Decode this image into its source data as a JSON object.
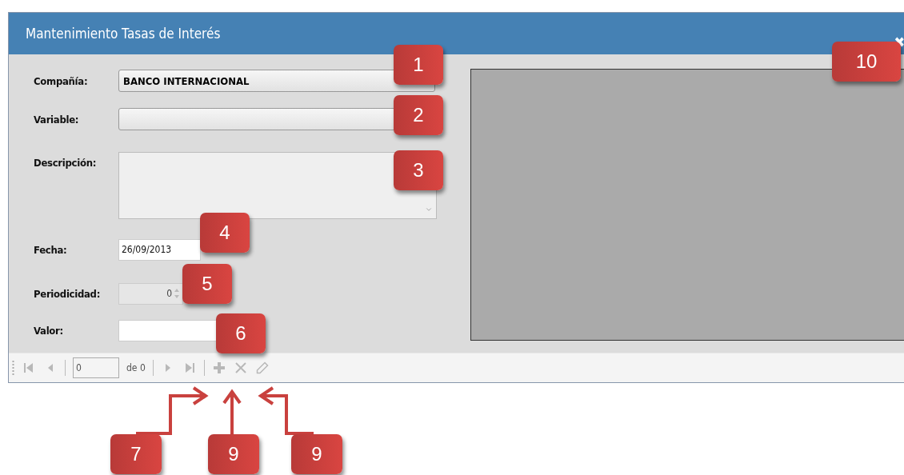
{
  "window": {
    "title": "Mantenimiento Tasas de Interés",
    "close": "✖"
  },
  "form": {
    "fields": [
      {
        "kind": "select",
        "label": "Compañía:",
        "value": "BANCO INTERNACIONAL",
        "disabled": false
      },
      {
        "kind": "select",
        "label": "Variable:",
        "disabled": false
      },
      {
        "kind": "textarea",
        "label": "Descripción:",
        "disabled": false
      },
      {
        "kind": "date",
        "label": "Fecha:",
        "value": "26/09/2013",
        "disabled": false
      },
      {
        "kind": "spinner",
        "label": "Periodicidad:",
        "value": "0",
        "disabled": true
      },
      {
        "kind": "text",
        "label": "Valor:",
        "disabled": false
      }
    ]
  },
  "toolbar": {
    "page": "0",
    "of": "de 0",
    "buttons": [
      {
        "kind": "first",
        "disabled": true
      },
      {
        "kind": "prev",
        "disabled": true
      },
      {
        "kind": "pager"
      },
      {
        "kind": "next",
        "disabled": true
      },
      {
        "kind": "last",
        "disabled": true
      },
      {
        "kind": "add",
        "disabled": true
      },
      {
        "kind": "delete",
        "disabled": true
      },
      {
        "kind": "edit",
        "disabled": true
      }
    ]
  },
  "callouts": [
    {
      "label": "1"
    },
    {
      "label": "2"
    },
    {
      "label": "3"
    },
    {
      "label": "4"
    },
    {
      "label": "5"
    },
    {
      "label": "6"
    },
    {
      "label": "10"
    },
    {
      "label": "7"
    },
    {
      "label": "9"
    },
    {
      "label": "9"
    }
  ]
}
